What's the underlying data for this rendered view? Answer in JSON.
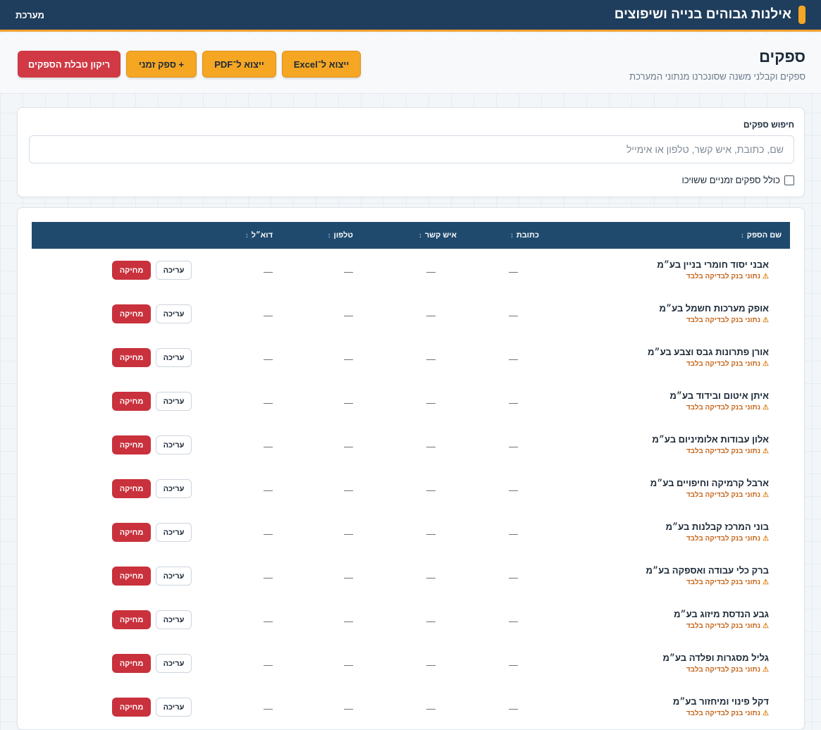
{
  "topbar": {
    "brand": "אילנות גבוהים בנייה ושיפוצים",
    "system_link": "מערכת"
  },
  "page": {
    "title": "ספקים",
    "subtitle": "ספקים וקבלני משנה שסונכרנו מנתוני המערכת"
  },
  "actions": {
    "export_excel": "ייצוא ל־Excel",
    "export_pdf": "ייצוא ל־PDF",
    "add_temp": "+ ספק זמני",
    "clear_table": "ריקון טבלת הספקים"
  },
  "search": {
    "label": "חיפוש ספקים",
    "placeholder": "שם, כתובת, איש קשר, טלפון או אימייל",
    "value": "",
    "include_temp_label": "כולל ספקים זמניים ששויכו",
    "include_temp_checked": false
  },
  "table": {
    "columns": {
      "name": "שם הספק",
      "address": "כתובת",
      "contact": "איש קשר",
      "phone": "טלפון",
      "email": "דוא״ל"
    },
    "sort_icon": "↕",
    "edit_label": "עריכה",
    "delete_label": "מחיקה",
    "warning_icon": "⚠",
    "rows": [
      {
        "name": "אבני יסוד חומרי בניין בע״מ",
        "note": "נתוני בנק לבדיקה בלבד",
        "address": "—",
        "contact": "—",
        "phone": "—",
        "email": "—"
      },
      {
        "name": "אופק מערכות חשמל בע״מ",
        "note": "נתוני בנק לבדיקה בלבד",
        "address": "—",
        "contact": "—",
        "phone": "—",
        "email": "—"
      },
      {
        "name": "אורן פתרונות גבס וצבע בע״מ",
        "note": "נתוני בנק לבדיקה בלבד",
        "address": "—",
        "contact": "—",
        "phone": "—",
        "email": "—"
      },
      {
        "name": "איתן איטום ובידוד בע״מ",
        "note": "נתוני בנק לבדיקה בלבד",
        "address": "—",
        "contact": "—",
        "phone": "—",
        "email": "—"
      },
      {
        "name": "אלון עבודות אלומיניום בע״מ",
        "note": "נתוני בנק לבדיקה בלבד",
        "address": "—",
        "contact": "—",
        "phone": "—",
        "email": "—"
      },
      {
        "name": "ארבל קרמיקה וחיפויים בע״מ",
        "note": "נתוני בנק לבדיקה בלבד",
        "address": "—",
        "contact": "—",
        "phone": "—",
        "email": "—"
      },
      {
        "name": "בוני המרכז קבלנות בע״מ",
        "note": "נתוני בנק לבדיקה בלבד",
        "address": "—",
        "contact": "—",
        "phone": "—",
        "email": "—"
      },
      {
        "name": "ברק כלי עבודה ואספקה בע״מ",
        "note": "נתוני בנק לבדיקה בלבד",
        "address": "—",
        "contact": "—",
        "phone": "—",
        "email": "—"
      },
      {
        "name": "גבע הנדסת מיזוג בע״מ",
        "note": "נתוני בנק לבדיקה בלבד",
        "address": "—",
        "contact": "—",
        "phone": "—",
        "email": "—"
      },
      {
        "name": "גליל מסגרות ופלדה בע״מ",
        "note": "נתוני בנק לבדיקה בלבד",
        "address": "—",
        "contact": "—",
        "phone": "—",
        "email": "—"
      },
      {
        "name": "דקל פינוי ומיחזור בע״מ",
        "note": "נתוני בנק לבדיקה בלבד",
        "address": "—",
        "contact": "—",
        "phone": "—",
        "email": "—"
      }
    ]
  }
}
